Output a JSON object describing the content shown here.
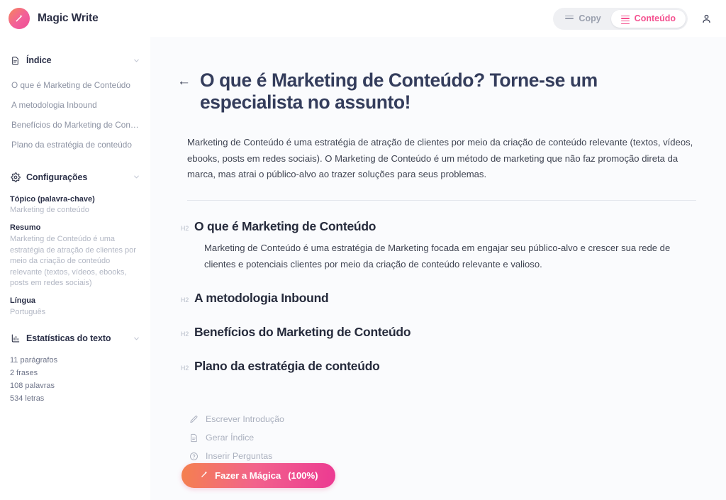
{
  "app": {
    "brand_name": "Magic Write",
    "logo_icon": "magic-wand-icon"
  },
  "topbar": {
    "view_toggle": {
      "options": [
        {
          "label": "Copy",
          "icon": "lines-icon",
          "active": false
        },
        {
          "label": "Conteúdo",
          "icon": "lines-icon",
          "active": true
        }
      ],
      "active_color": "#f4508f",
      "inactive_color": "#9aa0ae"
    },
    "account_icon": "user-icon"
  },
  "sidebar": {
    "index_panel": {
      "title": "Índice",
      "icon": "document-icon",
      "chevron": "chevron-down-icon",
      "items": [
        {
          "label": "O que é Marketing de Conteúdo"
        },
        {
          "label": "A metodologia Inbound"
        },
        {
          "label": "Benefícios do Marketing de Conteú…"
        },
        {
          "label": "Plano da estratégia de conteúdo"
        }
      ]
    },
    "settings_panel": {
      "title": "Configurações",
      "icon": "gear-icon",
      "chevron": "chevron-down-icon",
      "fields": [
        {
          "label": "Tópico (palavra-chave)",
          "value": "Marketing de conteúdo"
        },
        {
          "label": "Resumo",
          "value": "Marketing de Conteúdo é uma estratégia de atração de clientes por meio da criação de conteúdo relevante (textos, vídeos, ebooks, posts em redes sociais)"
        },
        {
          "label": "Língua",
          "value": "Português"
        }
      ]
    },
    "stats_panel": {
      "title": "Estatísticas do texto",
      "icon": "bar-chart-icon",
      "chevron": "chevron-down-icon",
      "lines": [
        "11 parágrafos",
        "2 frases",
        "108 palavras",
        "534 letras"
      ]
    }
  },
  "main": {
    "back_arrow": "←",
    "title": "O que é Marketing de Conteúdo? Torne-se um especialista no assunto!",
    "intro": "Marketing de Conteúdo é uma estratégia de atração de clientes por meio da criação de conteúdo relevante (textos, vídeos, ebooks, posts em redes sociais). O Marketing de Conteúdo é um método de marketing que não faz promoção direta da marca, mas atrai o público-alvo ao trazer soluções para seus problemas.",
    "sections": [
      {
        "tag": "H2",
        "heading": "O que é Marketing de Conteúdo",
        "body": "Marketing de Conteúdo é uma estratégia de Marketing focada em engajar seu público-alvo e crescer sua rede de clientes e potenciais clientes por meio da criação de conteúdo relevante e valioso."
      },
      {
        "tag": "H2",
        "heading": "A metodologia Inbound",
        "body": ""
      },
      {
        "tag": "H2",
        "heading": "Benefícios do Marketing de Conteúdo",
        "body": ""
      },
      {
        "tag": "H2",
        "heading": "Plano da estratégia de conteúdo",
        "body": ""
      }
    ],
    "suggestions": [
      {
        "label": "Escrever Introdução",
        "icon": "pencil-icon"
      },
      {
        "label": "Gerar Índice",
        "icon": "document-icon"
      },
      {
        "label": "Inserir Perguntas",
        "icon": "question-circle-icon"
      }
    ]
  },
  "footer": {
    "cta_label": "Fazer a Mágica",
    "cta_percent": "(100%)",
    "cta_icon": "magic-wand-icon",
    "cta_gradient_from": "#f4804f",
    "cta_gradient_to": "#ec3a92"
  }
}
